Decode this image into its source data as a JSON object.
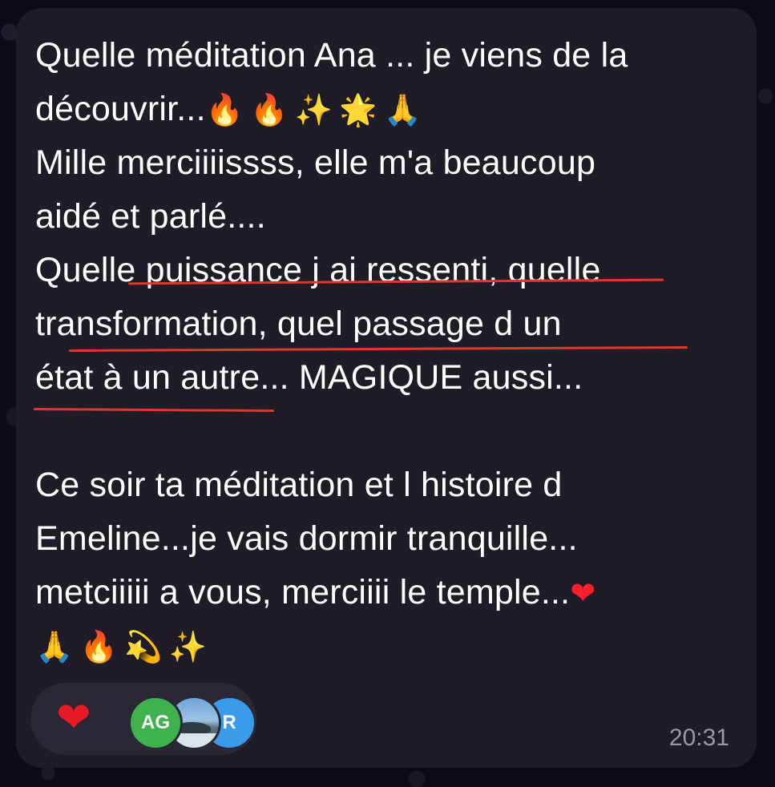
{
  "message": {
    "lines": [
      {
        "text": "Quelle méditation Ana ... je viens de la",
        "emojis": []
      },
      {
        "text": "découvrir...",
        "emojis": [
          {
            "name": "fire-icon",
            "glyph": "🔥",
            "cls": "fire"
          },
          {
            "name": "fire-icon",
            "glyph": "🔥",
            "cls": "fire"
          },
          {
            "name": "sparkles-icon",
            "glyph": "✨",
            "cls": "sparkles"
          },
          {
            "name": "glowing-star-icon",
            "glyph": "🌟",
            "cls": "star"
          },
          {
            "name": "praying-hands-icon",
            "glyph": "🙏",
            "cls": "pray"
          }
        ]
      },
      {
        "text": "Mille merciiiissss, elle m'a beaucoup",
        "emojis": []
      },
      {
        "text": "aidé et parlé....",
        "emojis": []
      },
      {
        "text": "Quelle puissance j ai ressenti, quelle",
        "emojis": []
      },
      {
        "text": "transformation, quel passage d un",
        "emojis": []
      },
      {
        "text": "état à un autre... MAGIQUE aussi...",
        "emojis": []
      },
      {
        "text": "",
        "emojis": []
      },
      {
        "text": "Ce soir ta méditation et l histoire d",
        "emojis": []
      },
      {
        "text": "Emeline...je vais dormir tranquille...",
        "emojis": []
      },
      {
        "text": "metciiiii a vous, merciiii le temple...",
        "emojis": [
          {
            "name": "red-heart-icon",
            "glyph": "❤",
            "cls": "heart"
          }
        ]
      },
      {
        "text": "",
        "emojis": [
          {
            "name": "praying-hands-icon",
            "glyph": "🙏",
            "cls": "pray"
          },
          {
            "name": "fire-icon",
            "glyph": "🔥",
            "cls": "fire"
          },
          {
            "name": "dizzy-icon",
            "glyph": "💫",
            "cls": "dizzy"
          },
          {
            "name": "sparkles-icon",
            "glyph": "✨",
            "cls": "sparkles"
          }
        ]
      }
    ]
  },
  "reactions": {
    "emoji": "❤",
    "avatars": [
      {
        "label": "AG",
        "color": "#3fb24f"
      },
      {
        "label": "",
        "color": "#6fa4d8"
      },
      {
        "label": "R",
        "color": "#3a9be8"
      }
    ]
  },
  "timestamp": "20:31",
  "colors": {
    "bubble": "#1f1c28",
    "text": "#ffffff",
    "underline": "#e2362c",
    "timestamp": "#9a97a6"
  }
}
